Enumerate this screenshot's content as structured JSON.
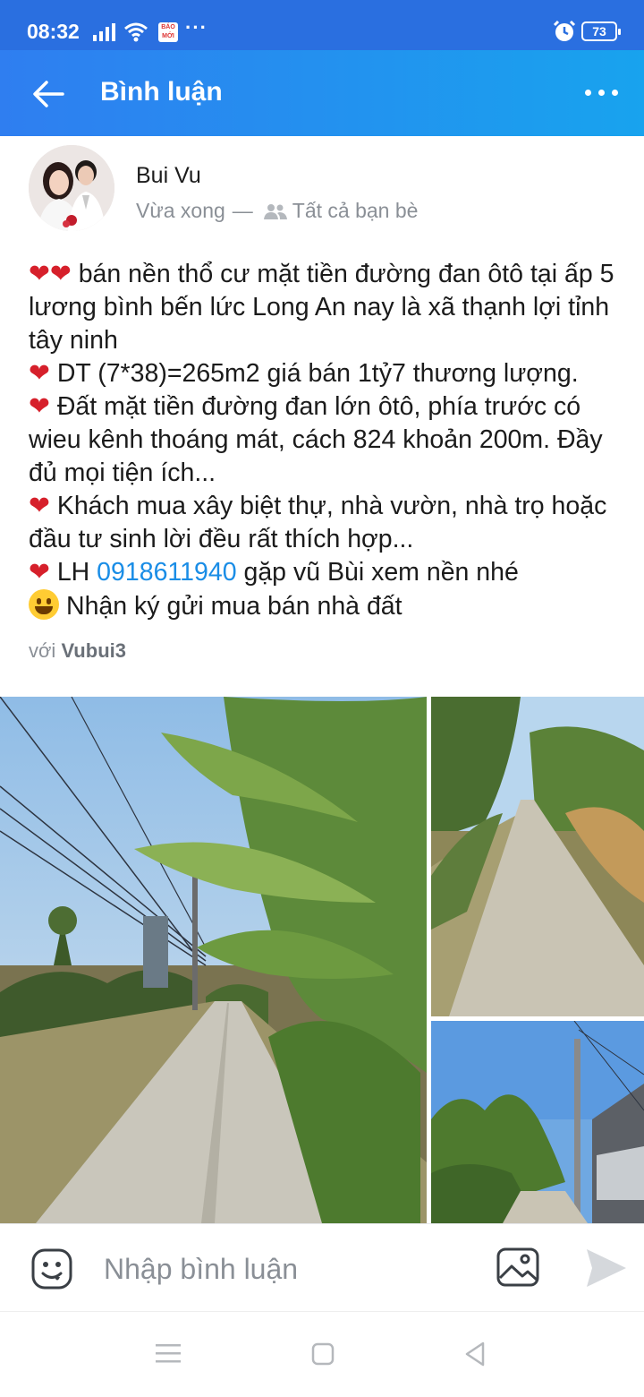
{
  "status_bar": {
    "time": "08:32",
    "battery": "73",
    "news_badge": "BÁO MỚI",
    "more": "···"
  },
  "header": {
    "title": "Bình luận"
  },
  "post": {
    "author": "Bui Vu",
    "time": "Vừa xong",
    "separator": "—",
    "privacy": "Tất cả bạn bè",
    "lines": [
      "bán nền thổ cư mặt tiền đường đan ôtô tại ấp 5 lương bình bến lức Long An nay là xã thạnh lợi tỉnh tây ninh",
      "DT (7*38)=265m2 giá bán 1tỷ7 thương lượng.",
      "Đất mặt tiền đường đan lớn ôtô, phía trước có wieu kênh thoáng mát, cách 824 khoản 200m. Đầy đủ mọi tiện ích...",
      "Khách mua xây biệt thự, nhà vườn, nhà trọ hoặc đầu tư sinh lời đều rất thích hợp...",
      "gặp vũ Bùi xem nền nhé",
      "Nhận ký gửi mua bán nhà đất"
    ],
    "lh_label": "LH",
    "phone": "0918611940",
    "with_prefix": "với",
    "tagged_user": "Vubui3"
  },
  "comment_bar": {
    "placeholder": "Nhập bình luận"
  },
  "icons": {
    "back": "arrow-left-icon",
    "more": "more-dots-icon",
    "emoji": "sticker-icon",
    "image": "image-icon",
    "send": "send-icon"
  },
  "colors": {
    "header_start": "#2f7ef0",
    "header_end": "#18a3ee",
    "heart": "#d6202b",
    "link": "#1a8de6"
  }
}
